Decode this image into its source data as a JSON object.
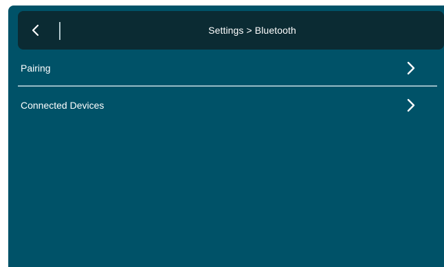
{
  "header": {
    "title": "Settings > Bluetooth",
    "back_icon": "chevron-left-icon"
  },
  "menu": {
    "items": [
      {
        "label": "Pairing",
        "icon": "chevron-right-icon"
      },
      {
        "label": "Connected Devices",
        "icon": "chevron-right-icon"
      }
    ]
  },
  "colors": {
    "background": "#005268",
    "header": "#0b2b33",
    "text": "#ffffff",
    "divider": "#a9c8d1"
  }
}
